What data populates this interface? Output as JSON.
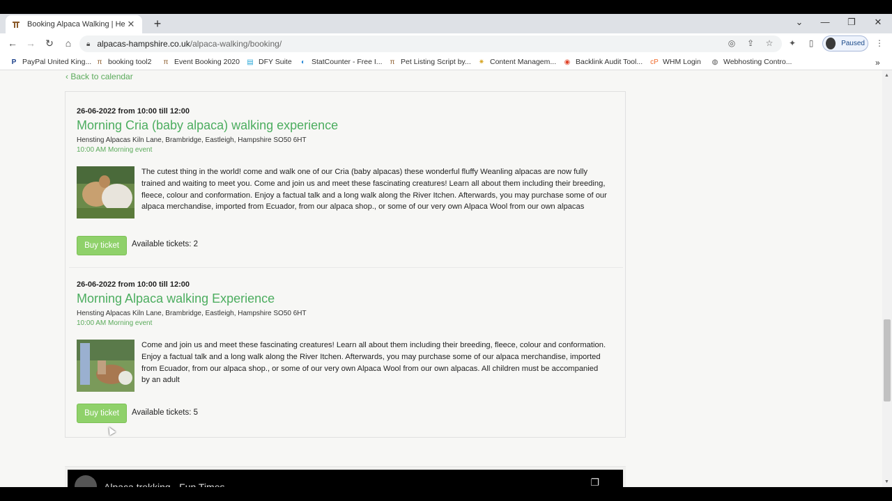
{
  "browser": {
    "tab_title": "Booking Alpaca Walking | Hensting",
    "url_domain": "alpacas-hampshire.co.uk",
    "url_path": "/alpaca-walking/booking/",
    "profile_label": "Paused"
  },
  "bookmarks": [
    {
      "label": "PayPal United King...",
      "icon": "paypal-icon"
    },
    {
      "label": "booking tool2",
      "icon": "alpaca-icon"
    },
    {
      "label": "Event Booking 2020",
      "icon": "alpaca-icon"
    },
    {
      "label": "DFY Suite",
      "icon": "dfy-icon"
    },
    {
      "label": "StatCounter - Free I...",
      "icon": "statcounter-icon"
    },
    {
      "label": "Pet Listing Script by...",
      "icon": "alpaca-icon"
    },
    {
      "label": "Content Managem...",
      "icon": "cms-icon"
    },
    {
      "label": "Backlink Audit Tool...",
      "icon": "semrush-icon"
    },
    {
      "label": "WHM Login",
      "icon": "cpanel-icon"
    },
    {
      "label": "Webhosting Contro...",
      "icon": "globe-icon"
    }
  ],
  "page": {
    "back_link": "Back to calendar",
    "events": [
      {
        "date": "26-06-2022 from 10:00 till 12:00",
        "name": "Morning Cria (baby alpaca) walking experience",
        "address": "Hensting Alpacas Kiln Lane, Brambridge, Eastleigh, Hampshire SO50 6HT",
        "time": "10:00 AM Morning event",
        "description": "The cutest thing in the world! come and walk one of our Cria (baby alpacas) these wonderful fluffy Weanling alpacas are now fully trained and waiting to meet you. Come and join us and meet these fascinating creatures! Learn all about them including their breeding, fleece, colour and conformation. Enjoy a factual talk and a long walk along the River Itchen. Afterwards, you may purchase some of our alpaca merchandise, imported from Ecuador, from our alpaca shop., or some of our very own Alpaca Wool from our own alpacas",
        "buy_label": "Buy ticket",
        "available": "Available tickets: 2"
      },
      {
        "date": "26-06-2022 from 10:00 till 12:00",
        "name": "Morning Alpaca walking Experience",
        "address": "Hensting Alpacas Kiln Lane, Brambridge, Eastleigh, Hampshire SO50 6HT",
        "time": "10:00 AM Morning event",
        "description": "Come and join us and meet these fascinating creatures! Learn all about them including their breeding, fleece, colour and conformation. Enjoy a factual talk and a long walk along the River Itchen. Afterwards, you may purchase some of our alpaca merchandise, imported from Ecuador, from our alpaca shop., or some of our very own Alpaca Wool from our own alpacas. All children must be accompanied by an adult",
        "buy_label": "Buy ticket",
        "available": "Available tickets: 5"
      }
    ],
    "video_title": "Alpaca trekking - Fun Times"
  },
  "colors": {
    "accent_green": "#4cad5f",
    "button_green": "#8fd16a"
  }
}
